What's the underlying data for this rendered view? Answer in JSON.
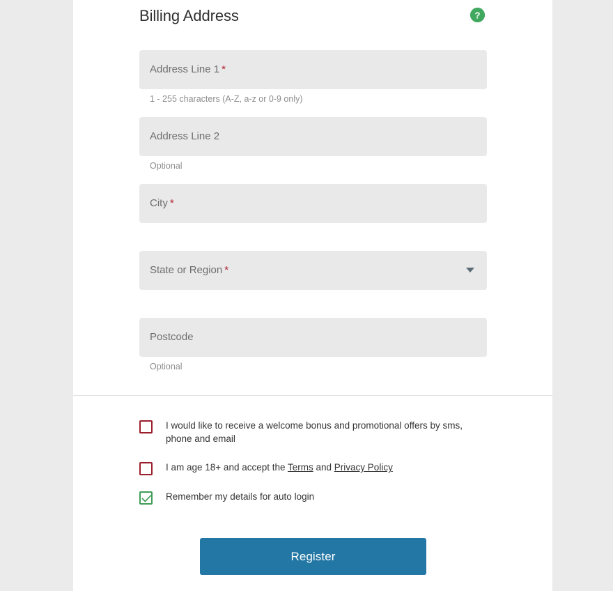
{
  "theme": {
    "page_background": "#ebebeb",
    "card_background": "#ffffff",
    "field_background": "#e9e9e9",
    "accent_button": "#2377a4",
    "required_star": "#b02030",
    "checkbox_unchecked_border": "#9c1f2e",
    "checkbox_checked_border": "#3f9e57",
    "help_icon_background": "#41a85f",
    "divider": "#e4e4e4"
  },
  "section": {
    "title": "Billing Address",
    "help_icon": "help-question-circle-icon",
    "help_glyph": "?"
  },
  "fields": [
    {
      "name": "address-line-1",
      "label": "Address Line 1",
      "required": true,
      "star": "*",
      "value": "",
      "placeholder": "Address Line 1",
      "hint": "1 - 255 characters (A-Z, a-z or 0-9 only)",
      "type": "text"
    },
    {
      "name": "address-line-2",
      "label": "Address Line 2",
      "required": false,
      "star": "",
      "value": "",
      "placeholder": "Address Line 2",
      "hint": "Optional",
      "type": "text"
    },
    {
      "name": "city",
      "label": "City",
      "required": true,
      "star": "*",
      "value": "",
      "placeholder": "City",
      "hint": "",
      "type": "text"
    },
    {
      "name": "state-or-region",
      "label": "State or Region",
      "required": true,
      "star": "*",
      "value": "",
      "placeholder": "State or Region",
      "hint": "",
      "type": "select",
      "caret_icon": "chevron-down-icon"
    },
    {
      "name": "postcode",
      "label": "Postcode",
      "required": false,
      "star": "",
      "value": "",
      "placeholder": "Postcode",
      "hint": "Optional",
      "type": "text"
    }
  ],
  "consents": [
    {
      "name": "marketing-opt-in",
      "checked": false,
      "text_before": "I would like to receive a welcome bonus and promotional offers by sms, phone and email",
      "links": []
    },
    {
      "name": "terms-accept",
      "checked": false,
      "text_before": "I am age 18+ and accept the ",
      "link_1": "Terms",
      "text_middle": " and ",
      "link_2": "Privacy Policy",
      "text_after": ""
    },
    {
      "name": "remember-details",
      "checked": true,
      "text_before": "Remember my details for auto login",
      "links": []
    }
  ],
  "submit": {
    "label": "Register"
  }
}
